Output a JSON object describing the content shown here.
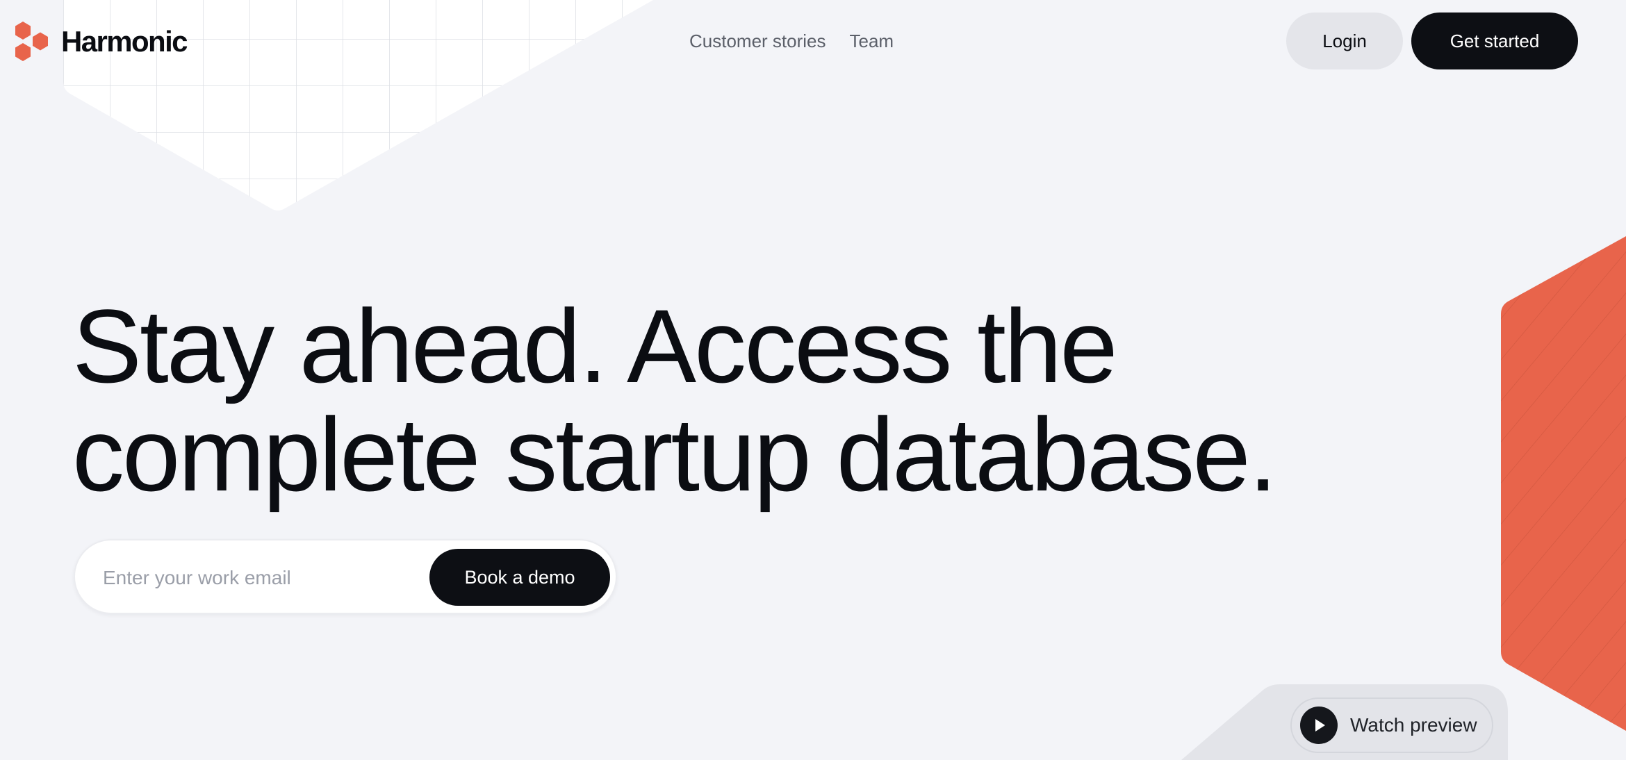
{
  "brand": {
    "name": "Harmonic",
    "accent_color": "#e8644b",
    "dark_color": "#0d0f14",
    "background_color": "#f3f4f8"
  },
  "nav": {
    "items": [
      {
        "label": "Customer stories"
      },
      {
        "label": "Team"
      }
    ]
  },
  "header": {
    "login_label": "Login",
    "get_started_label": "Get started"
  },
  "hero": {
    "headline_line1": "Stay ahead. Access the",
    "headline_line2": "complete startup database."
  },
  "signup": {
    "email_placeholder": "Enter your work email",
    "email_value": "",
    "cta_label": "Book a demo"
  },
  "preview": {
    "label": "Watch preview",
    "icon": "play-icon"
  }
}
